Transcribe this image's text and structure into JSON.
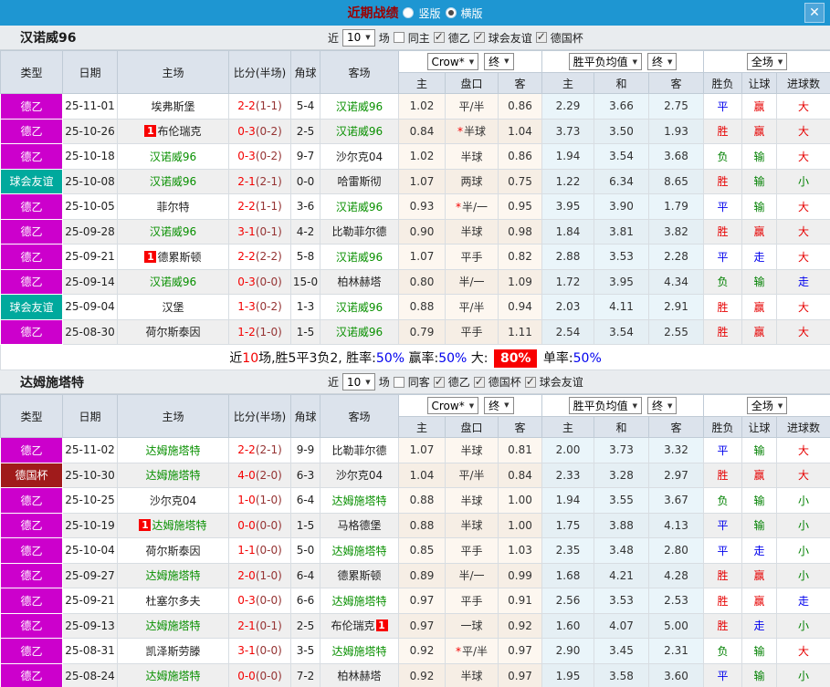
{
  "topbar": {
    "title": "近期战绩",
    "radios": [
      {
        "label": "竖版",
        "selected": false
      },
      {
        "label": "横版",
        "selected": true
      }
    ],
    "close_label": "✕"
  },
  "badge_text": "1",
  "table_columns": {
    "type": "类型",
    "date": "日期",
    "home": "主场",
    "score": "比分(半场)",
    "corners": "角球",
    "away": "客场",
    "selects": {
      "crow": "Crow*",
      "final1": "终",
      "avg": "胜平负均值",
      "final2": "终",
      "full": "全场"
    },
    "sub_headers": [
      "主",
      "盘口",
      "客",
      "主",
      "和",
      "客",
      "胜负",
      "让球",
      "进球数"
    ]
  },
  "colors": {
    "type_map": {
      "德乙": "#cc00cc",
      "球会友谊": "#00a99d",
      "德国杯": "#a01b1b"
    },
    "result_map": {
      "胜": "#e60000",
      "赢": "#e60000",
      "大": "#e60000",
      "平": "#0000ee",
      "走": "#0000ee",
      "负": "#008000",
      "输": "#008000",
      "小": "#008000"
    }
  },
  "sections": [
    {
      "team": "汉诺威96",
      "filter": {
        "near_label": "近",
        "count": "10",
        "games_label": "场",
        "same_label": "同主",
        "same_checked": false,
        "leagues": [
          {
            "label": "德乙",
            "checked": true
          },
          {
            "label": "球会友谊",
            "checked": true
          },
          {
            "label": "德国杯",
            "checked": true
          }
        ]
      },
      "rows": [
        {
          "type": "德乙",
          "date": "25-11-01",
          "home": {
            "name": "埃弗斯堡",
            "green": false,
            "badge": null
          },
          "score": "2-2",
          "half": "(1-1)",
          "corners": "5-4",
          "away": {
            "name": "汉诺威96",
            "green": true,
            "badge": null
          },
          "crow": {
            "home": "1.02",
            "star": false,
            "handicap": "平/半",
            "away": "0.86"
          },
          "avg": [
            "2.29",
            "3.66",
            "2.75"
          ],
          "full": [
            "平",
            "赢",
            "大"
          ]
        },
        {
          "type": "德乙",
          "date": "25-10-26",
          "home": {
            "name": "布伦瑞克",
            "green": false,
            "badge": "before"
          },
          "score": "0-3",
          "half": "(0-2)",
          "corners": "2-5",
          "away": {
            "name": "汉诺威96",
            "green": true,
            "badge": null
          },
          "crow": {
            "home": "0.84",
            "star": true,
            "handicap": "半球",
            "away": "1.04"
          },
          "avg": [
            "3.73",
            "3.50",
            "1.93"
          ],
          "full": [
            "胜",
            "赢",
            "大"
          ]
        },
        {
          "type": "德乙",
          "date": "25-10-18",
          "home": {
            "name": "汉诺威96",
            "green": true,
            "badge": null
          },
          "score": "0-3",
          "half": "(0-2)",
          "corners": "9-7",
          "away": {
            "name": "沙尔克04",
            "green": false,
            "badge": null
          },
          "crow": {
            "home": "1.02",
            "star": false,
            "handicap": "半球",
            "away": "0.86"
          },
          "avg": [
            "1.94",
            "3.54",
            "3.68"
          ],
          "full": [
            "负",
            "输",
            "大"
          ]
        },
        {
          "type": "球会友谊",
          "date": "25-10-08",
          "home": {
            "name": "汉诺威96",
            "green": true,
            "badge": null
          },
          "score": "2-1",
          "half": "(2-1)",
          "corners": "0-0",
          "away": {
            "name": "哈雷斯彻",
            "green": false,
            "badge": null
          },
          "crow": {
            "home": "1.07",
            "star": false,
            "handicap": "两球",
            "away": "0.75"
          },
          "avg": [
            "1.22",
            "6.34",
            "8.65"
          ],
          "full": [
            "胜",
            "输",
            "小"
          ]
        },
        {
          "type": "德乙",
          "date": "25-10-05",
          "home": {
            "name": "菲尔特",
            "green": false,
            "badge": null
          },
          "score": "2-2",
          "half": "(1-1)",
          "corners": "3-6",
          "away": {
            "name": "汉诺威96",
            "green": true,
            "badge": null
          },
          "crow": {
            "home": "0.93",
            "star": true,
            "handicap": "半/一",
            "away": "0.95"
          },
          "avg": [
            "3.95",
            "3.90",
            "1.79"
          ],
          "full": [
            "平",
            "输",
            "大"
          ]
        },
        {
          "type": "德乙",
          "date": "25-09-28",
          "home": {
            "name": "汉诺威96",
            "green": true,
            "badge": null
          },
          "score": "3-1",
          "half": "(0-1)",
          "corners": "4-2",
          "away": {
            "name": "比勒菲尔德",
            "green": false,
            "badge": null
          },
          "crow": {
            "home": "0.90",
            "star": false,
            "handicap": "半球",
            "away": "0.98"
          },
          "avg": [
            "1.84",
            "3.81",
            "3.82"
          ],
          "full": [
            "胜",
            "赢",
            "大"
          ]
        },
        {
          "type": "德乙",
          "date": "25-09-21",
          "home": {
            "name": "德累斯顿",
            "green": false,
            "badge": "before"
          },
          "score": "2-2",
          "half": "(2-2)",
          "corners": "5-8",
          "away": {
            "name": "汉诺威96",
            "green": true,
            "badge": null
          },
          "crow": {
            "home": "1.07",
            "star": false,
            "handicap": "平手",
            "away": "0.82"
          },
          "avg": [
            "2.88",
            "3.53",
            "2.28"
          ],
          "full": [
            "平",
            "走",
            "大"
          ]
        },
        {
          "type": "德乙",
          "date": "25-09-14",
          "home": {
            "name": "汉诺威96",
            "green": true,
            "badge": null
          },
          "score": "0-3",
          "half": "(0-0)",
          "corners": "15-0",
          "away": {
            "name": "柏林赫塔",
            "green": false,
            "badge": null
          },
          "crow": {
            "home": "0.80",
            "star": false,
            "handicap": "半/一",
            "away": "1.09"
          },
          "avg": [
            "1.72",
            "3.95",
            "4.34"
          ],
          "full": [
            "负",
            "输",
            "走"
          ]
        },
        {
          "type": "球会友谊",
          "date": "25-09-04",
          "home": {
            "name": "汉堡",
            "green": false,
            "badge": null
          },
          "score": "1-3",
          "half": "(0-2)",
          "corners": "1-3",
          "away": {
            "name": "汉诺威96",
            "green": true,
            "badge": null
          },
          "crow": {
            "home": "0.88",
            "star": false,
            "handicap": "平/半",
            "away": "0.94"
          },
          "avg": [
            "2.03",
            "4.11",
            "2.91"
          ],
          "full": [
            "胜",
            "赢",
            "大"
          ]
        },
        {
          "type": "德乙",
          "date": "25-08-30",
          "home": {
            "name": "荷尔斯泰因",
            "green": false,
            "badge": null
          },
          "score": "1-2",
          "half": "(1-0)",
          "corners": "1-5",
          "away": {
            "name": "汉诺威96",
            "green": true,
            "badge": null
          },
          "crow": {
            "home": "0.79",
            "star": false,
            "handicap": "平手",
            "away": "1.11"
          },
          "avg": [
            "2.54",
            "3.54",
            "2.55"
          ],
          "full": [
            "胜",
            "赢",
            "大"
          ]
        }
      ],
      "summary": [
        {
          "text": "近",
          "style": "plain"
        },
        {
          "text": "10",
          "style": "red"
        },
        {
          "text": "场,胜5平3负2, 胜率:",
          "style": "plain"
        },
        {
          "text": "50%",
          "style": "blue"
        },
        {
          "text": " 赢率:",
          "style": "plain"
        },
        {
          "text": "50%",
          "style": "blue"
        },
        {
          "text": " 大: ",
          "style": "plain"
        },
        {
          "text": "80%",
          "style": "red-badge"
        },
        {
          "text": " 单率:",
          "style": "plain"
        },
        {
          "text": "50%",
          "style": "blue"
        }
      ]
    },
    {
      "team": "达姆施塔特",
      "filter": {
        "near_label": "近",
        "count": "10",
        "games_label": "场",
        "same_label": "同客",
        "same_checked": false,
        "leagues": [
          {
            "label": "德乙",
            "checked": true
          },
          {
            "label": "德国杯",
            "checked": true
          },
          {
            "label": "球会友谊",
            "checked": true
          }
        ]
      },
      "rows": [
        {
          "type": "德乙",
          "date": "25-11-02",
          "home": {
            "name": "达姆施塔特",
            "green": true,
            "badge": null
          },
          "score": "2-2",
          "half": "(2-1)",
          "corners": "9-9",
          "away": {
            "name": "比勒菲尔德",
            "green": false,
            "badge": null
          },
          "crow": {
            "home": "1.07",
            "star": false,
            "handicap": "半球",
            "away": "0.81"
          },
          "avg": [
            "2.00",
            "3.73",
            "3.32"
          ],
          "full": [
            "平",
            "输",
            "大"
          ]
        },
        {
          "type": "德国杯",
          "date": "25-10-30",
          "home": {
            "name": "达姆施塔特",
            "green": true,
            "badge": null
          },
          "score": "4-0",
          "half": "(2-0)",
          "corners": "6-3",
          "away": {
            "name": "沙尔克04",
            "green": false,
            "badge": null
          },
          "crow": {
            "home": "1.04",
            "star": false,
            "handicap": "平/半",
            "away": "0.84"
          },
          "avg": [
            "2.33",
            "3.28",
            "2.97"
          ],
          "full": [
            "胜",
            "赢",
            "大"
          ]
        },
        {
          "type": "德乙",
          "date": "25-10-25",
          "home": {
            "name": "沙尔克04",
            "green": false,
            "badge": null
          },
          "score": "1-0",
          "half": "(1-0)",
          "corners": "6-4",
          "away": {
            "name": "达姆施塔特",
            "green": true,
            "badge": null
          },
          "crow": {
            "home": "0.88",
            "star": false,
            "handicap": "半球",
            "away": "1.00"
          },
          "avg": [
            "1.94",
            "3.55",
            "3.67"
          ],
          "full": [
            "负",
            "输",
            "小"
          ]
        },
        {
          "type": "德乙",
          "date": "25-10-19",
          "home": {
            "name": "达姆施塔特",
            "green": true,
            "badge": "before"
          },
          "score": "0-0",
          "half": "(0-0)",
          "corners": "1-5",
          "away": {
            "name": "马格德堡",
            "green": false,
            "badge": null
          },
          "crow": {
            "home": "0.88",
            "star": false,
            "handicap": "半球",
            "away": "1.00"
          },
          "avg": [
            "1.75",
            "3.88",
            "4.13"
          ],
          "full": [
            "平",
            "输",
            "小"
          ]
        },
        {
          "type": "德乙",
          "date": "25-10-04",
          "home": {
            "name": "荷尔斯泰因",
            "green": false,
            "badge": null
          },
          "score": "1-1",
          "half": "(0-0)",
          "corners": "5-0",
          "away": {
            "name": "达姆施塔特",
            "green": true,
            "badge": null
          },
          "crow": {
            "home": "0.85",
            "star": false,
            "handicap": "平手",
            "away": "1.03"
          },
          "avg": [
            "2.35",
            "3.48",
            "2.80"
          ],
          "full": [
            "平",
            "走",
            "小"
          ]
        },
        {
          "type": "德乙",
          "date": "25-09-27",
          "home": {
            "name": "达姆施塔特",
            "green": true,
            "badge": null
          },
          "score": "2-0",
          "half": "(1-0)",
          "corners": "6-4",
          "away": {
            "name": "德累斯顿",
            "green": false,
            "badge": null
          },
          "crow": {
            "home": "0.89",
            "star": false,
            "handicap": "半/一",
            "away": "0.99"
          },
          "avg": [
            "1.68",
            "4.21",
            "4.28"
          ],
          "full": [
            "胜",
            "赢",
            "小"
          ]
        },
        {
          "type": "德乙",
          "date": "25-09-21",
          "home": {
            "name": "杜塞尔多夫",
            "green": false,
            "badge": null
          },
          "score": "0-3",
          "half": "(0-0)",
          "corners": "6-6",
          "away": {
            "name": "达姆施塔特",
            "green": true,
            "badge": null
          },
          "crow": {
            "home": "0.97",
            "star": false,
            "handicap": "平手",
            "away": "0.91"
          },
          "avg": [
            "2.56",
            "3.53",
            "2.53"
          ],
          "full": [
            "胜",
            "赢",
            "走"
          ]
        },
        {
          "type": "德乙",
          "date": "25-09-13",
          "home": {
            "name": "达姆施塔特",
            "green": true,
            "badge": null
          },
          "score": "2-1",
          "half": "(0-1)",
          "corners": "2-5",
          "away": {
            "name": "布伦瑞克",
            "green": false,
            "badge": "after"
          },
          "crow": {
            "home": "0.97",
            "star": false,
            "handicap": "一球",
            "away": "0.92"
          },
          "avg": [
            "1.60",
            "4.07",
            "5.00"
          ],
          "full": [
            "胜",
            "走",
            "小"
          ]
        },
        {
          "type": "德乙",
          "date": "25-08-31",
          "home": {
            "name": "凯泽斯劳滕",
            "green": false,
            "badge": null
          },
          "score": "3-1",
          "half": "(0-0)",
          "corners": "3-5",
          "away": {
            "name": "达姆施塔特",
            "green": true,
            "badge": null
          },
          "crow": {
            "home": "0.92",
            "star": true,
            "handicap": "平/半",
            "away": "0.97"
          },
          "avg": [
            "2.90",
            "3.45",
            "2.31"
          ],
          "full": [
            "负",
            "输",
            "大"
          ]
        },
        {
          "type": "德乙",
          "date": "25-08-24",
          "home": {
            "name": "达姆施塔特",
            "green": true,
            "badge": null
          },
          "score": "0-0",
          "half": "(0-0)",
          "corners": "7-2",
          "away": {
            "name": "柏林赫塔",
            "green": false,
            "badge": null
          },
          "crow": {
            "home": "0.92",
            "star": false,
            "handicap": "半球",
            "away": "0.97"
          },
          "avg": [
            "1.95",
            "3.58",
            "3.60"
          ],
          "full": [
            "平",
            "输",
            "小"
          ]
        }
      ],
      "summary": null
    }
  ]
}
